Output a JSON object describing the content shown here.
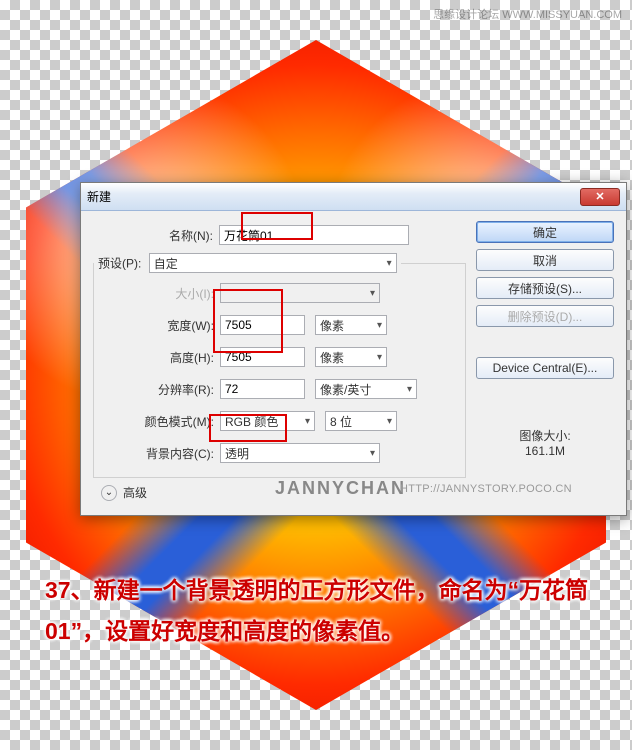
{
  "watermark_top": "思缘设计论坛  WWW.MISSYUAN.COM",
  "dialog": {
    "title": "新建",
    "name_label": "名称(N):",
    "name_value": "万花筒01",
    "preset_label": "预设(P):",
    "preset_value": "自定",
    "size_label": "大小(I):",
    "width_label": "宽度(W):",
    "width_value": "7505",
    "width_unit": "像素",
    "height_label": "高度(H):",
    "height_value": "7505",
    "height_unit": "像素",
    "res_label": "分辨率(R):",
    "res_value": "72",
    "res_unit": "像素/英寸",
    "mode_label": "颜色模式(M):",
    "mode_value": "RGB 颜色",
    "bit_value": "8 位",
    "bg_label": "背景内容(C):",
    "bg_value": "透明",
    "advanced": "高级",
    "image_size_label": "图像大小:",
    "image_size_value": "161.1M"
  },
  "buttons": {
    "ok": "确定",
    "cancel": "取消",
    "save_preset": "存储预设(S)...",
    "delete_preset": "删除预设(D)...",
    "device_central": "Device Central(E)..."
  },
  "watermark_janny": "JANNYCHAN",
  "watermark_url": "HTTP://JANNYSTORY.POCO.CN",
  "caption": "37、新建一个背景透明的正方形文件，命名为“万花筒01”，设置好宽度和高度的像素值。"
}
